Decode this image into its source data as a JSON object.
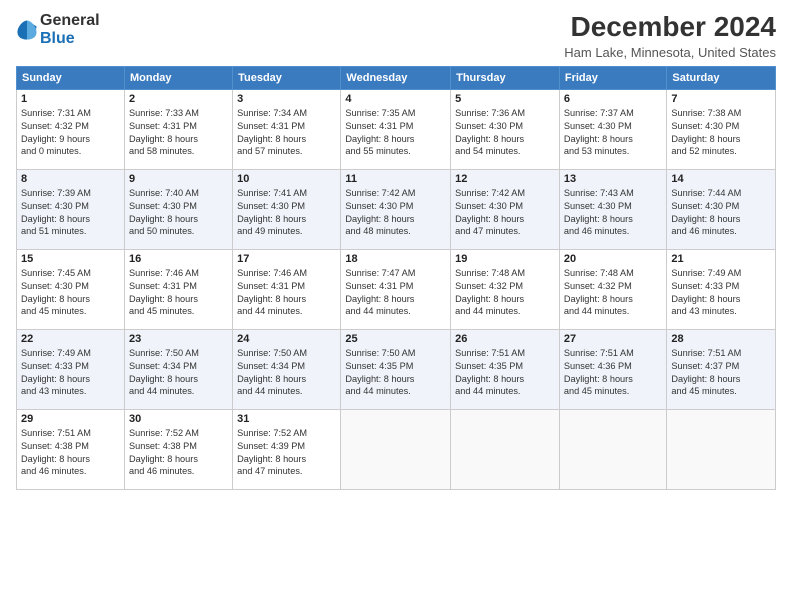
{
  "header": {
    "logo_line1": "General",
    "logo_line2": "Blue",
    "title": "December 2024",
    "subtitle": "Ham Lake, Minnesota, United States"
  },
  "calendar": {
    "weekdays": [
      "Sunday",
      "Monday",
      "Tuesday",
      "Wednesday",
      "Thursday",
      "Friday",
      "Saturday"
    ],
    "weeks": [
      [
        {
          "day": "1",
          "info": "Sunrise: 7:31 AM\nSunset: 4:32 PM\nDaylight: 9 hours\nand 0 minutes."
        },
        {
          "day": "2",
          "info": "Sunrise: 7:33 AM\nSunset: 4:31 PM\nDaylight: 8 hours\nand 58 minutes."
        },
        {
          "day": "3",
          "info": "Sunrise: 7:34 AM\nSunset: 4:31 PM\nDaylight: 8 hours\nand 57 minutes."
        },
        {
          "day": "4",
          "info": "Sunrise: 7:35 AM\nSunset: 4:31 PM\nDaylight: 8 hours\nand 55 minutes."
        },
        {
          "day": "5",
          "info": "Sunrise: 7:36 AM\nSunset: 4:30 PM\nDaylight: 8 hours\nand 54 minutes."
        },
        {
          "day": "6",
          "info": "Sunrise: 7:37 AM\nSunset: 4:30 PM\nDaylight: 8 hours\nand 53 minutes."
        },
        {
          "day": "7",
          "info": "Sunrise: 7:38 AM\nSunset: 4:30 PM\nDaylight: 8 hours\nand 52 minutes."
        }
      ],
      [
        {
          "day": "8",
          "info": "Sunrise: 7:39 AM\nSunset: 4:30 PM\nDaylight: 8 hours\nand 51 minutes."
        },
        {
          "day": "9",
          "info": "Sunrise: 7:40 AM\nSunset: 4:30 PM\nDaylight: 8 hours\nand 50 minutes."
        },
        {
          "day": "10",
          "info": "Sunrise: 7:41 AM\nSunset: 4:30 PM\nDaylight: 8 hours\nand 49 minutes."
        },
        {
          "day": "11",
          "info": "Sunrise: 7:42 AM\nSunset: 4:30 PM\nDaylight: 8 hours\nand 48 minutes."
        },
        {
          "day": "12",
          "info": "Sunrise: 7:42 AM\nSunset: 4:30 PM\nDaylight: 8 hours\nand 47 minutes."
        },
        {
          "day": "13",
          "info": "Sunrise: 7:43 AM\nSunset: 4:30 PM\nDaylight: 8 hours\nand 46 minutes."
        },
        {
          "day": "14",
          "info": "Sunrise: 7:44 AM\nSunset: 4:30 PM\nDaylight: 8 hours\nand 46 minutes."
        }
      ],
      [
        {
          "day": "15",
          "info": "Sunrise: 7:45 AM\nSunset: 4:30 PM\nDaylight: 8 hours\nand 45 minutes."
        },
        {
          "day": "16",
          "info": "Sunrise: 7:46 AM\nSunset: 4:31 PM\nDaylight: 8 hours\nand 45 minutes."
        },
        {
          "day": "17",
          "info": "Sunrise: 7:46 AM\nSunset: 4:31 PM\nDaylight: 8 hours\nand 44 minutes."
        },
        {
          "day": "18",
          "info": "Sunrise: 7:47 AM\nSunset: 4:31 PM\nDaylight: 8 hours\nand 44 minutes."
        },
        {
          "day": "19",
          "info": "Sunrise: 7:48 AM\nSunset: 4:32 PM\nDaylight: 8 hours\nand 44 minutes."
        },
        {
          "day": "20",
          "info": "Sunrise: 7:48 AM\nSunset: 4:32 PM\nDaylight: 8 hours\nand 44 minutes."
        },
        {
          "day": "21",
          "info": "Sunrise: 7:49 AM\nSunset: 4:33 PM\nDaylight: 8 hours\nand 43 minutes."
        }
      ],
      [
        {
          "day": "22",
          "info": "Sunrise: 7:49 AM\nSunset: 4:33 PM\nDaylight: 8 hours\nand 43 minutes."
        },
        {
          "day": "23",
          "info": "Sunrise: 7:50 AM\nSunset: 4:34 PM\nDaylight: 8 hours\nand 44 minutes."
        },
        {
          "day": "24",
          "info": "Sunrise: 7:50 AM\nSunset: 4:34 PM\nDaylight: 8 hours\nand 44 minutes."
        },
        {
          "day": "25",
          "info": "Sunrise: 7:50 AM\nSunset: 4:35 PM\nDaylight: 8 hours\nand 44 minutes."
        },
        {
          "day": "26",
          "info": "Sunrise: 7:51 AM\nSunset: 4:35 PM\nDaylight: 8 hours\nand 44 minutes."
        },
        {
          "day": "27",
          "info": "Sunrise: 7:51 AM\nSunset: 4:36 PM\nDaylight: 8 hours\nand 45 minutes."
        },
        {
          "day": "28",
          "info": "Sunrise: 7:51 AM\nSunset: 4:37 PM\nDaylight: 8 hours\nand 45 minutes."
        }
      ],
      [
        {
          "day": "29",
          "info": "Sunrise: 7:51 AM\nSunset: 4:38 PM\nDaylight: 8 hours\nand 46 minutes."
        },
        {
          "day": "30",
          "info": "Sunrise: 7:52 AM\nSunset: 4:38 PM\nDaylight: 8 hours\nand 46 minutes."
        },
        {
          "day": "31",
          "info": "Sunrise: 7:52 AM\nSunset: 4:39 PM\nDaylight: 8 hours\nand 47 minutes."
        },
        {
          "day": "",
          "info": ""
        },
        {
          "day": "",
          "info": ""
        },
        {
          "day": "",
          "info": ""
        },
        {
          "day": "",
          "info": ""
        }
      ]
    ]
  }
}
